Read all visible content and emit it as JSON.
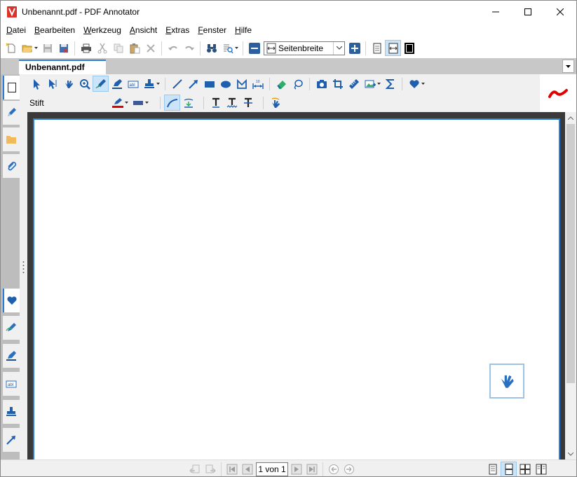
{
  "window": {
    "title": "Unbenannt.pdf - PDF Annotator"
  },
  "menu": {
    "items": [
      {
        "label": "Datei",
        "key": "D",
        "rest": "atei"
      },
      {
        "label": "Bearbeiten",
        "key": "B",
        "rest": "earbeiten"
      },
      {
        "label": "Werkzeug",
        "key": "W",
        "rest": "erkzeug"
      },
      {
        "label": "Ansicht",
        "key": "A",
        "rest": "nsicht"
      },
      {
        "label": "Extras",
        "key": "E",
        "rest": "xtras"
      },
      {
        "label": "Fenster",
        "key": "F",
        "rest": "enster"
      },
      {
        "label": "Hilfe",
        "key": "H",
        "rest": "ilfe"
      }
    ]
  },
  "toolbar": {
    "zoom_value": "Seitenbreite"
  },
  "tabs": {
    "active_label": "Unbenannt.pdf"
  },
  "annotation": {
    "tool_label": "Stift",
    "pen_color": "#e00000",
    "fill_color": "#3c5a9a",
    "accent": "#2b7cd3"
  },
  "statusbar": {
    "page_field": "1 von 1"
  }
}
